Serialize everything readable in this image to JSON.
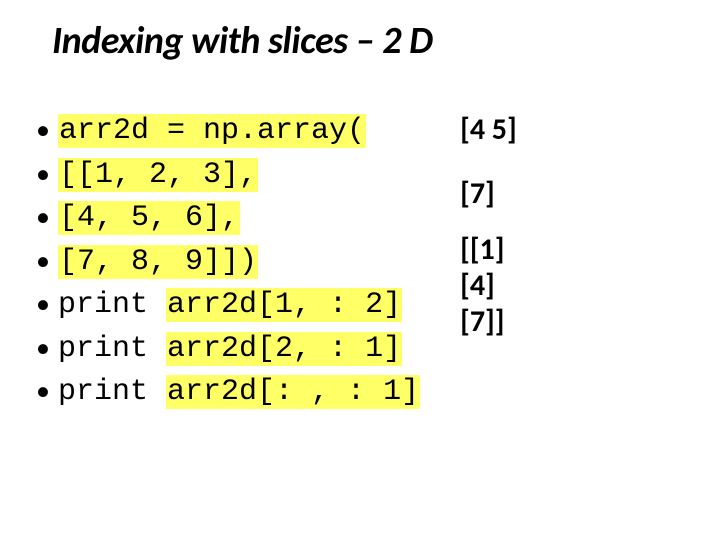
{
  "title": "Indexing with slices – 2 D",
  "code": {
    "l1": "arr2d = np.array(",
    "l2": "[[1, 2, 3],",
    "l3": "[4, 5, 6],",
    "l4": "[7, 8, 9]])",
    "l5_a": "print ",
    "l5_b": "arr2d[1, : 2]",
    "l6_a": "print ",
    "l6_b": "arr2d[2, : 1]",
    "l7_a": "print ",
    "l7_b": "arr2d[: , : 1]"
  },
  "output": {
    "o1": "[4 5]",
    "o2": "[7]",
    "o3a": "[[1]",
    "o3b": " [4]",
    "o3c": " [7]]"
  }
}
